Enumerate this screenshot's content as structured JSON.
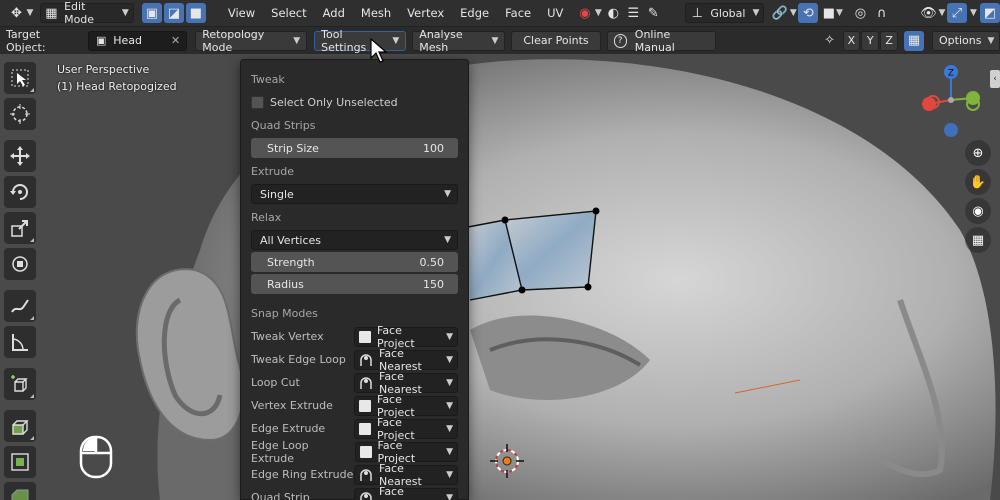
{
  "header": {
    "mode_label": "Edit Mode",
    "menus": [
      "View",
      "Select",
      "Add",
      "Mesh",
      "Vertex",
      "Edge",
      "Face",
      "UV"
    ],
    "transform_orientation": "Global"
  },
  "toolbar2": {
    "target_object_label": "Target Object:",
    "target_object_value": "Head",
    "retopology_mode": "Retopology Mode",
    "tool_settings": "Tool Settings",
    "analyse_mesh": "Analyse Mesh",
    "clear_points": "Clear Points",
    "online_manual": "Online Manual",
    "axes": [
      "X",
      "Y",
      "Z"
    ],
    "options": "Options"
  },
  "viewport": {
    "perspective": "User Perspective",
    "object_name": "(1) Head Retopogized"
  },
  "panel": {
    "tweak_header": "Tweak",
    "select_only_unselected": "Select Only Unselected",
    "select_only_unselected_checked": false,
    "quad_strips_header": "Quad Strips",
    "strip_size_label": "Strip Size",
    "strip_size_value": "100",
    "extrude_header": "Extrude",
    "extrude_value": "Single",
    "relax_header": "Relax",
    "relax_value": "All Vertices",
    "strength_label": "Strength",
    "strength_value": "0.50",
    "radius_label": "Radius",
    "radius_value": "150",
    "snap_modes_header": "Snap Modes",
    "snap_modes": [
      {
        "label": "Tweak Vertex",
        "value": "Face Project",
        "icon": "square"
      },
      {
        "label": "Tweak Edge Loop",
        "value": "Face Nearest",
        "icon": "nearest"
      },
      {
        "label": "Loop Cut",
        "value": "Face Nearest",
        "icon": "nearest"
      },
      {
        "label": "Vertex Extrude",
        "value": "Face Project",
        "icon": "square"
      },
      {
        "label": "Edge Extrude",
        "value": "Face Project",
        "icon": "square"
      },
      {
        "label": "Edge Loop Extrude",
        "value": "Face Project",
        "icon": "square"
      },
      {
        "label": "Edge Ring Extrude",
        "value": "Face Nearest",
        "icon": "nearest"
      },
      {
        "label": "Quad Strip",
        "value": "Face Nearest",
        "icon": "nearest"
      }
    ]
  },
  "colors": {
    "accent": "#4772b3",
    "panel_bg": "#2a2a2a",
    "header_bg": "#2f2f2f",
    "gizmo_x": "#e0473f",
    "gizmo_y": "#7fb53a",
    "gizmo_z": "#3d78d8"
  }
}
